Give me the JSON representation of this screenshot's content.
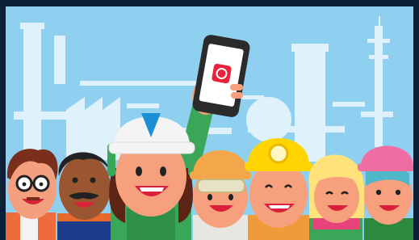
{
  "scene": {
    "subject": "cartoon-workers-illustration",
    "elements": [
      "industrial-skyline",
      "worker-glasses",
      "worker-mustache",
      "worker-raising-phone",
      "worker-orange-hard-hat",
      "worker-yellow-hard-hat-lamp",
      "worker-blonde",
      "worker-pink-cap"
    ]
  },
  "palette": {
    "frame": "#0c2138",
    "sky": "#8fd0f0",
    "silhouette": "#dff2fb",
    "skin_light": "#f7a07d",
    "skin_dark": "#9a5531",
    "green_uniform": "#3aa657",
    "helmet_white": "#f4f4f4",
    "helmet_blue": "#1a8fd6",
    "helmet_orange": "#f4a64a",
    "helmet_yellow": "#ffd400",
    "cap_pink": "#ef6ea1",
    "app_red": "#e8233b"
  },
  "phone": {
    "app_icon": "phone-app-icon"
  }
}
